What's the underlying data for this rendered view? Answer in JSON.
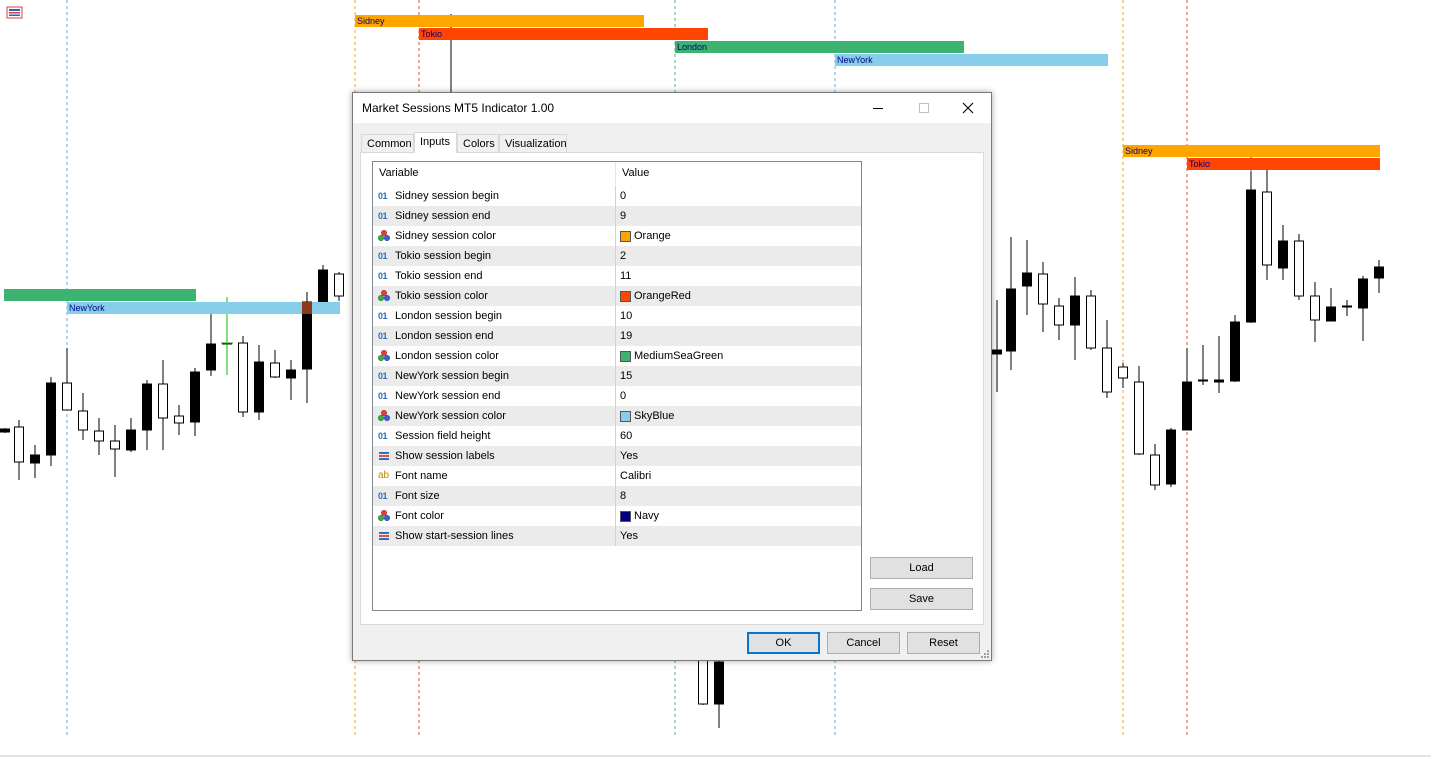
{
  "chart": {
    "upper_sessions": [
      {
        "label": "Sidney",
        "color": "#FFA500"
      },
      {
        "label": "Tokio",
        "color": "#FF4500"
      },
      {
        "label": "London",
        "color": "#3CB371"
      },
      {
        "label": "NewYork",
        "color": "#87CEEB"
      }
    ],
    "left_sessions": [
      {
        "label": "",
        "color": "#3CB371"
      },
      {
        "label": "NewYork",
        "color": "#87CEEB"
      }
    ],
    "right_sessions": [
      {
        "label": "Sidney",
        "color": "#FFA500"
      },
      {
        "label": "Tokio",
        "color": "#FF4500"
      }
    ],
    "label_color": "#000080"
  },
  "dialog": {
    "title": "Market Sessions MT5 Indicator 1.00",
    "tabs": [
      {
        "label": "Common",
        "active": false
      },
      {
        "label": "Inputs",
        "active": true
      },
      {
        "label": "Colors",
        "active": false
      },
      {
        "label": "Visualization",
        "active": false
      }
    ],
    "table": {
      "columns": [
        "Variable",
        "Value"
      ],
      "rows": [
        {
          "type": "int",
          "variable": "Sidney session begin",
          "value": "0"
        },
        {
          "type": "int",
          "variable": "Sidney session end",
          "value": "9"
        },
        {
          "type": "color",
          "variable": "Sidney session color",
          "value": "Orange",
          "swatch": "#FFA500"
        },
        {
          "type": "int",
          "variable": "Tokio session begin",
          "value": "2"
        },
        {
          "type": "int",
          "variable": "Tokio session end",
          "value": "11"
        },
        {
          "type": "color",
          "variable": "Tokio session color",
          "value": "OrangeRed",
          "swatch": "#FF4500"
        },
        {
          "type": "int",
          "variable": "London session begin",
          "value": "10"
        },
        {
          "type": "int",
          "variable": "London session end",
          "value": "19"
        },
        {
          "type": "color",
          "variable": "London session color",
          "value": "MediumSeaGreen",
          "swatch": "#3CB371"
        },
        {
          "type": "int",
          "variable": "NewYork session begin",
          "value": "15"
        },
        {
          "type": "int",
          "variable": "NewYork session end",
          "value": "0"
        },
        {
          "type": "color",
          "variable": "NewYork session color",
          "value": "SkyBlue",
          "swatch": "#87CEEB"
        },
        {
          "type": "int",
          "variable": "Session field height",
          "value": "60"
        },
        {
          "type": "bool",
          "variable": "Show session labels",
          "value": "Yes"
        },
        {
          "type": "string",
          "variable": "Font name",
          "value": "Calibri"
        },
        {
          "type": "int",
          "variable": "Font size",
          "value": "8"
        },
        {
          "type": "color",
          "variable": "Font color",
          "value": "Navy",
          "swatch": "#000080"
        },
        {
          "type": "bool",
          "variable": "Show start-session lines",
          "value": "Yes"
        }
      ]
    },
    "buttons": {
      "load": "Load",
      "save": "Save",
      "ok": "OK",
      "cancel": "Cancel",
      "reset": "Reset"
    },
    "icons": {
      "int": "01",
      "string": "ab",
      "color": "color-icon",
      "bool": "bool-icon"
    }
  }
}
